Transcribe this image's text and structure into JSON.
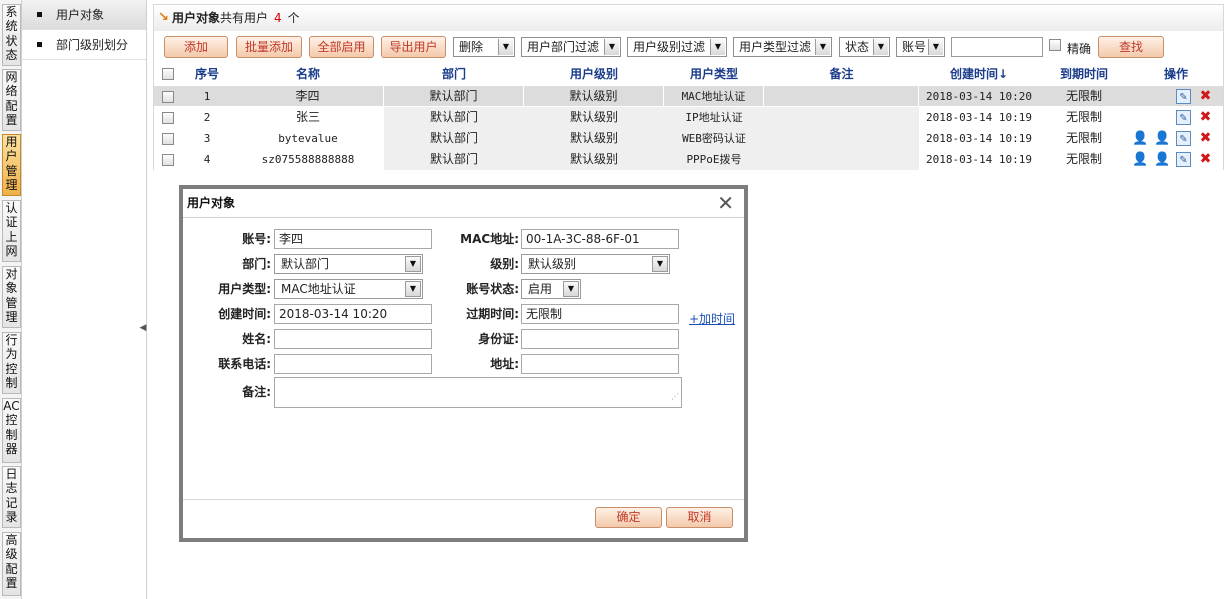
{
  "left_nav": [
    {
      "label": "系统状态"
    },
    {
      "label": "网络配置"
    },
    {
      "label": "用户管理"
    },
    {
      "label": "认证上网"
    },
    {
      "label": "对象管理"
    },
    {
      "label": "行为控制"
    },
    {
      "label": "AC控制器"
    },
    {
      "label": "日志记录"
    },
    {
      "label": "高级配置"
    }
  ],
  "sub_nav": [
    {
      "label": "用户对象"
    },
    {
      "label": "部门级别划分"
    }
  ],
  "header": {
    "title": "用户对象",
    "prefix": "共有用户",
    "count": "4",
    "suffix": "个"
  },
  "toolbar": {
    "add": "添加",
    "batch_add": "批量添加",
    "enable_all": "全部启用",
    "export": "导出用户",
    "delete": "删除",
    "dept_filter": "用户部门过滤",
    "level_filter": "用户级别过滤",
    "type_filter": "用户类型过滤",
    "status": "状态",
    "account": "账号",
    "account_value": "",
    "exact_label": "精确",
    "search": "查找"
  },
  "table": {
    "headers": [
      "序号",
      "名称",
      "部门",
      "用户级别",
      "用户类型",
      "备注",
      "创建时间↓",
      "到期时间",
      "操作"
    ],
    "rows": [
      {
        "no": "1",
        "name": "李四",
        "dept": "默认部门",
        "level": "默认级别",
        "type": "MAC地址认证",
        "note": "",
        "created": "2018-03-14 10:20",
        "expire": "无限制"
      },
      {
        "no": "2",
        "name": "张三",
        "dept": "默认部门",
        "level": "默认级别",
        "type": "IP地址认证",
        "note": "",
        "created": "2018-03-14 10:19",
        "expire": "无限制"
      },
      {
        "no": "3",
        "name": "bytevalue",
        "dept": "默认部门",
        "level": "默认级别",
        "type": "WEB密码认证",
        "note": "",
        "created": "2018-03-14 10:19",
        "expire": "无限制"
      },
      {
        "no": "4",
        "name": "sz075588888888",
        "dept": "默认部门",
        "level": "默认级别",
        "type": "PPPoE拨号",
        "note": "",
        "created": "2018-03-14 10:19",
        "expire": "无限制"
      }
    ]
  },
  "dialog": {
    "title": "用户对象",
    "close": "✕",
    "labels": {
      "account": "账号:",
      "mac": "MAC地址:",
      "dept": "部门:",
      "level": "级别:",
      "usertype": "用户类型:",
      "status": "账号状态:",
      "created": "创建时间:",
      "expire": "过期时间:",
      "name": "姓名:",
      "idcard": "身份证:",
      "phone": "联系电话:",
      "address": "地址:",
      "note": "备注:"
    },
    "values": {
      "account": "李四",
      "mac": "00-1A-3C-88-6F-01",
      "dept": "默认部门",
      "level": "默认级别",
      "usertype": "MAC地址认证",
      "status": "启用",
      "created": "2018-03-14 10:20",
      "expire": "无限制",
      "name": "",
      "idcard": "",
      "phone": "",
      "address": "",
      "note": ""
    },
    "add_time": "+加时间",
    "ok": "确定",
    "cancel": "取消"
  },
  "icons": {
    "sort": "arrow-down-icon",
    "edit": "pencil-icon",
    "delete": "delete-x-icon",
    "add_user": "add-user-icon",
    "remove_user": "remove-user-icon"
  }
}
